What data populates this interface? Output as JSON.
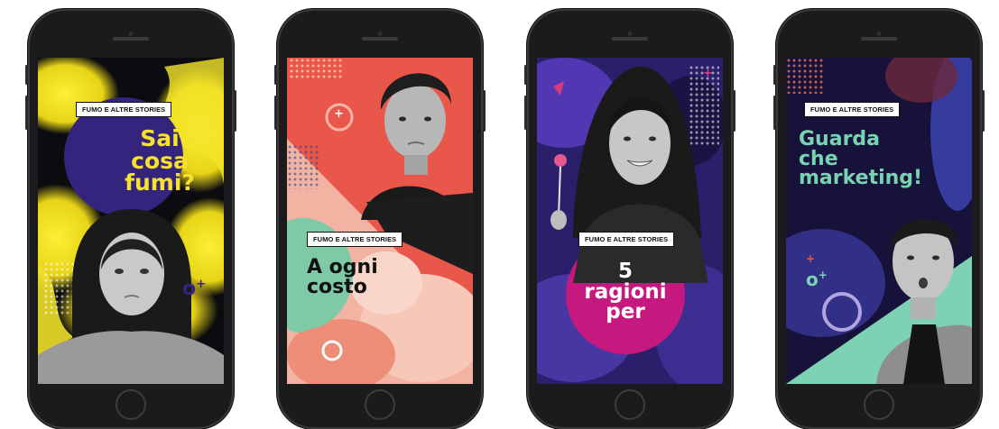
{
  "tag_label": "FUMO E ALTRE STORIES",
  "phones": [
    {
      "headline": [
        "Sai",
        "cosa",
        "fumi?"
      ],
      "accent": "#f6e12b",
      "bg": "#0b0b10",
      "circle": "#35247e"
    },
    {
      "headline": [
        "A ogni",
        "costo"
      ],
      "accent": "#e8574a",
      "bg": "#e8574a",
      "circle": "#7fcaa6"
    },
    {
      "headline": [
        "5",
        "ragioni",
        "per"
      ],
      "accent": "#ffffff",
      "bg": "#2a1f6a",
      "circle": "#c5197f"
    },
    {
      "headline": [
        "Guarda",
        "che",
        "marketing!"
      ],
      "accent": "#77d3b1",
      "bg": "#16123a",
      "circle": "#7cd2b2"
    }
  ]
}
